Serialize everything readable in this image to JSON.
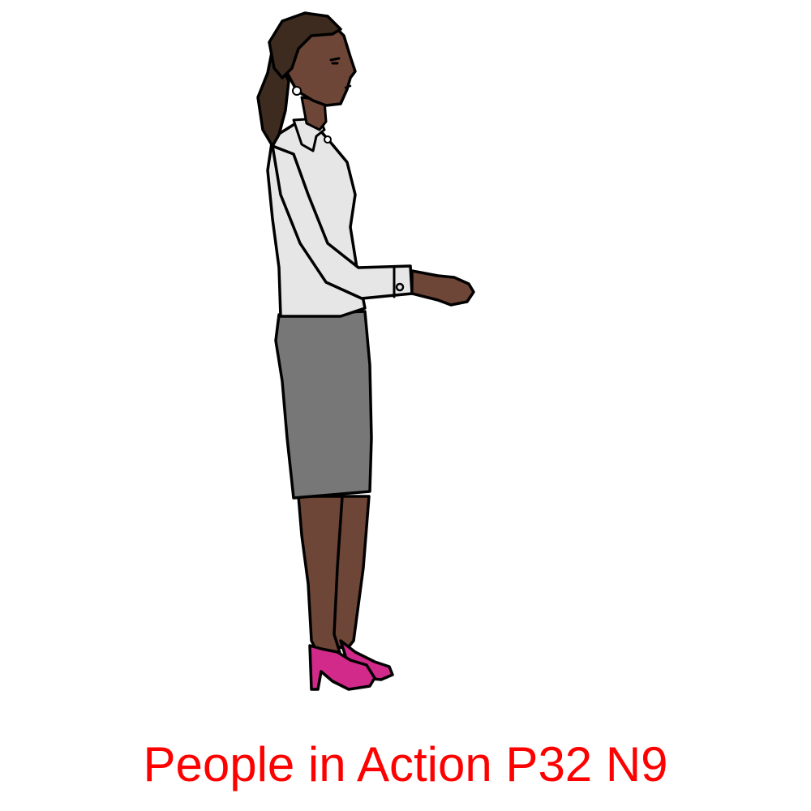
{
  "caption": {
    "text": "People in Action P32 N9",
    "color": "#ff0000"
  },
  "illustration": {
    "subject": "woman-standing-side-view",
    "colors": {
      "skin": "#6e4638",
      "hair": "#3d2b1f",
      "blouse": "#e6e6e6",
      "skirt": "#777777",
      "shoes": "#d12a8a",
      "outline": "#000000",
      "background": "#ffffff"
    }
  }
}
